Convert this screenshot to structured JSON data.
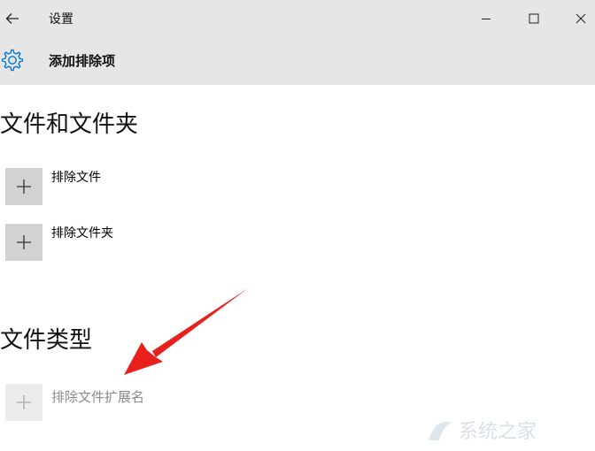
{
  "window": {
    "title": "设置"
  },
  "header": {
    "title": "添加排除项"
  },
  "sections": {
    "files_folders": {
      "heading": "文件和文件夹",
      "exclude_file_label": "排除文件",
      "exclude_folder_label": "排除文件夹"
    },
    "file_types": {
      "heading": "文件类型",
      "exclude_extension_label": "排除文件扩展名"
    }
  },
  "icons": {
    "back": "back-arrow-icon",
    "settings": "gear-icon",
    "add": "plus-icon",
    "minimize": "minimize-icon",
    "maximize": "maximize-icon",
    "close": "close-icon",
    "annotation": "red-arrow-annotation"
  },
  "colors": {
    "accent": "#0078d7",
    "annotation_arrow": "#e8201c",
    "titlebar_bg": "#e6e6e6",
    "add_button_bg": "#d2d2d2"
  },
  "watermark": {
    "text": "系统之家"
  }
}
